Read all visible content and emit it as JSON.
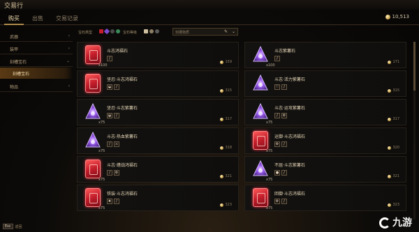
{
  "window": {
    "title": "交易行"
  },
  "tabs": [
    {
      "label": "购买",
      "active": true
    },
    {
      "label": "出售",
      "active": false
    },
    {
      "label": "交易记录",
      "active": false
    }
  ],
  "currency": {
    "amount": "10,513"
  },
  "sidebar": {
    "items": [
      {
        "label": "武器",
        "kind": "top",
        "chevron": "‹"
      },
      {
        "label": "装甲",
        "kind": "top",
        "chevron": "‹"
      },
      {
        "label": "刻槽宝石",
        "kind": "top-active",
        "chevron": "⌄"
      },
      {
        "label": "刻槽宝石",
        "kind": "sub-active",
        "chevron": ""
      },
      {
        "label": "物品",
        "kind": "top",
        "chevron": "‹"
      }
    ]
  },
  "filters": {
    "gem_type_label": "宝石类型",
    "gem_grade_label": "宝石等级",
    "search_placeholder": "刻槽物质"
  },
  "cards": [
    {
      "name": "斗志鸿福石",
      "gem": "red",
      "qty": "x100",
      "price": "159",
      "tags": [
        "/"
      ]
    },
    {
      "name": "斗志紫薯石",
      "gem": "purple",
      "qty": "x100",
      "price": "171",
      "tags": [
        "/"
      ]
    },
    {
      "name": "坚忍·斗志鸿福石",
      "gem": "red",
      "qty": "",
      "price": "315",
      "tags": [
        "◒",
        "/"
      ]
    },
    {
      "name": "斗志·活力紫薯石",
      "gem": "purple",
      "qty": "",
      "price": "315",
      "tags": [
        "♡",
        "/"
      ]
    },
    {
      "name": "坚忍·斗志紫薯石",
      "gem": "purple",
      "qty": "x75",
      "price": "317",
      "tags": [
        "◒",
        "/"
      ]
    },
    {
      "name": "斗志·运攻紫薯石",
      "gem": "purple",
      "qty": "x75",
      "price": "317",
      "tags": [
        "/",
        "⚙"
      ]
    },
    {
      "name": "斗志·热血紫薯石",
      "gem": "purple",
      "qty": "x75",
      "price": "318",
      "tags": [
        "/",
        "⚔"
      ]
    },
    {
      "name": "运御·斗志鸿福石",
      "gem": "red",
      "qty": "x75",
      "price": "320",
      "tags": [
        "⚙",
        "/"
      ]
    },
    {
      "name": "斗志·缠战鸿福石",
      "gem": "red",
      "qty": "x75",
      "price": "321",
      "tags": [
        "/",
        "⚙"
      ]
    },
    {
      "name": "不屈·斗志紫薯石",
      "gem": "purple",
      "qty": "x75",
      "price": "321",
      "tags": [
        "●",
        "/"
      ]
    },
    {
      "name": "铁装·斗志鸿福石",
      "gem": "red",
      "qty": "x75",
      "price": "323",
      "tags": [
        "♠",
        "/"
      ]
    },
    {
      "name": "回御·斗志鸿福石",
      "gem": "red",
      "qty": "x75",
      "price": "323",
      "tags": [
        "⚙",
        "/"
      ]
    }
  ],
  "bottom": {
    "key": "Esc",
    "label": "返回"
  },
  "watermark": {
    "text": "九游"
  },
  "colors": {
    "accent": "#b08a4a",
    "panel": "#131210",
    "gem_red": "#c21d2a",
    "gem_purple": "#7a4cd0"
  }
}
